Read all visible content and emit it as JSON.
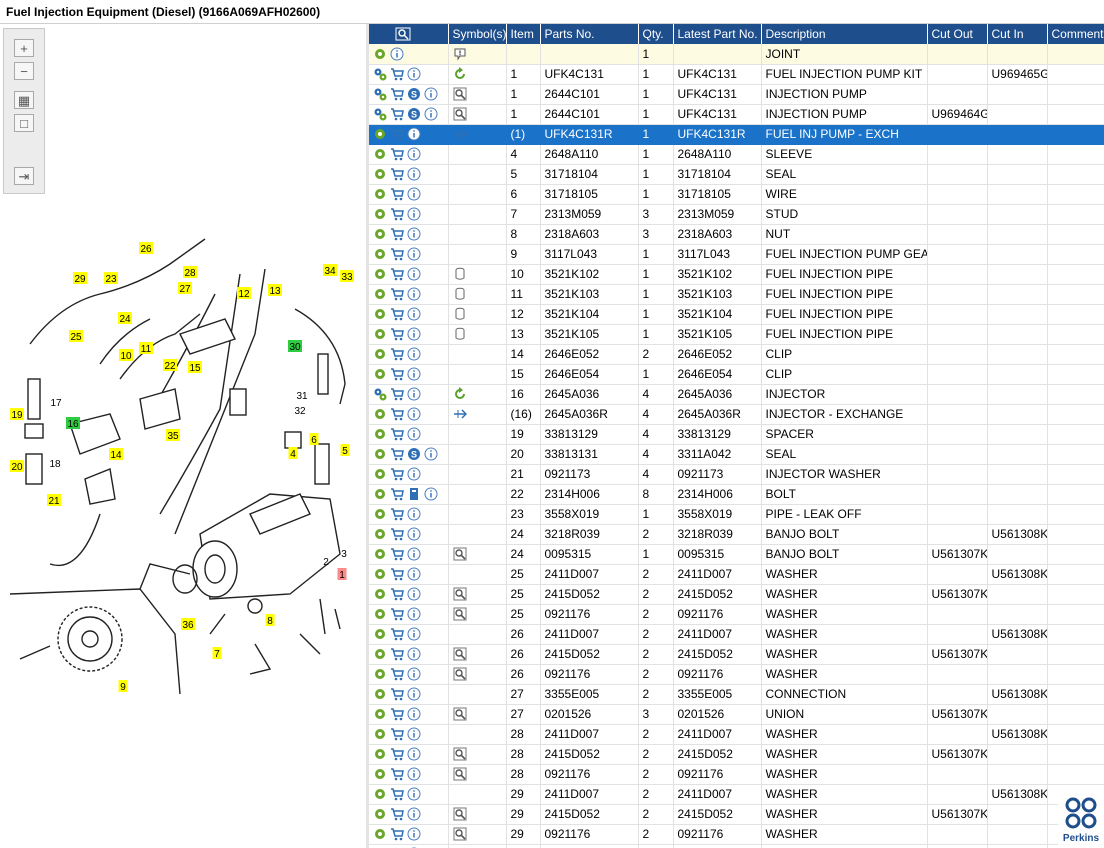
{
  "window": {
    "title": "Fuel Injection Equipment (Diesel) (9166A069AFH02600)"
  },
  "toolbox": {
    "zoom_in": "+",
    "zoom_out": "−",
    "fit": "▦",
    "box": "□",
    "panel": "⇥"
  },
  "columns": [
    "",
    "Symbol(s)",
    "Item",
    "Parts No.",
    "Qty.",
    "Latest Part No.",
    "Description",
    "Cut Out",
    "Cut In",
    "Comment"
  ],
  "rows": [
    {
      "a": [
        "gear",
        "info"
      ],
      "sym": "note",
      "item": "",
      "part": "",
      "qty": "1",
      "latest": "",
      "desc": "JOINT",
      "out": "",
      "in": "",
      "c": "",
      "style": "hl"
    },
    {
      "a": [
        "gears",
        "cart",
        "info"
      ],
      "sym": "refresh",
      "item": "1",
      "part": "UFK4C131",
      "qty": "1",
      "latest": "UFK4C131",
      "desc": "FUEL INJECTION PUMP KIT",
      "out": "",
      "in": "U969465G",
      "c": ""
    },
    {
      "a": [
        "gears",
        "cart",
        "s",
        "info"
      ],
      "sym": "mag",
      "item": "1",
      "part": "2644C101",
      "qty": "1",
      "latest": "UFK4C131",
      "desc": "INJECTION PUMP",
      "out": "",
      "in": "",
      "c": ""
    },
    {
      "a": [
        "gears",
        "cart",
        "s",
        "info"
      ],
      "sym": "mag",
      "item": "1",
      "part": "2644C101",
      "qty": "1",
      "latest": "UFK4C131",
      "desc": "INJECTION PUMP",
      "out": "U969464G",
      "in": "",
      "c": ""
    },
    {
      "a": [
        "gear",
        "cart",
        "info"
      ],
      "sym": "exchange",
      "item": "(1)",
      "part": "UFK4C131R",
      "qty": "1",
      "latest": "UFK4C131R",
      "desc": "FUEL INJ PUMP - EXCH",
      "out": "",
      "in": "",
      "c": "",
      "style": "sel"
    },
    {
      "a": [
        "gear",
        "cart",
        "info"
      ],
      "sym": "",
      "item": "4",
      "part": "2648A110",
      "qty": "1",
      "latest": "2648A110",
      "desc": "SLEEVE",
      "out": "",
      "in": "",
      "c": ""
    },
    {
      "a": [
        "gear",
        "cart",
        "info"
      ],
      "sym": "",
      "item": "5",
      "part": "31718104",
      "qty": "1",
      "latest": "31718104",
      "desc": "SEAL",
      "out": "",
      "in": "",
      "c": ""
    },
    {
      "a": [
        "gear",
        "cart",
        "info"
      ],
      "sym": "",
      "item": "6",
      "part": "31718105",
      "qty": "1",
      "latest": "31718105",
      "desc": "WIRE",
      "out": "",
      "in": "",
      "c": ""
    },
    {
      "a": [
        "gear",
        "cart",
        "info"
      ],
      "sym": "",
      "item": "7",
      "part": "2313M059",
      "qty": "3",
      "latest": "2313M059",
      "desc": "STUD",
      "out": "",
      "in": "",
      "c": ""
    },
    {
      "a": [
        "gear",
        "cart",
        "info"
      ],
      "sym": "",
      "item": "8",
      "part": "2318A603",
      "qty": "3",
      "latest": "2318A603",
      "desc": "NUT",
      "out": "",
      "in": "",
      "c": ""
    },
    {
      "a": [
        "gear",
        "cart",
        "info"
      ],
      "sym": "",
      "item": "9",
      "part": "3117L043",
      "qty": "1",
      "latest": "3117L043",
      "desc": "FUEL INJECTION PUMP GEAR",
      "out": "",
      "in": "",
      "c": ""
    },
    {
      "a": [
        "gear",
        "cart",
        "info"
      ],
      "sym": "can",
      "item": "10",
      "part": "3521K102",
      "qty": "1",
      "latest": "3521K102",
      "desc": "FUEL INJECTION PIPE",
      "out": "",
      "in": "",
      "c": ""
    },
    {
      "a": [
        "gear",
        "cart",
        "info"
      ],
      "sym": "can",
      "item": "11",
      "part": "3521K103",
      "qty": "1",
      "latest": "3521K103",
      "desc": "FUEL INJECTION PIPE",
      "out": "",
      "in": "",
      "c": ""
    },
    {
      "a": [
        "gear",
        "cart",
        "info"
      ],
      "sym": "can",
      "item": "12",
      "part": "3521K104",
      "qty": "1",
      "latest": "3521K104",
      "desc": "FUEL INJECTION PIPE",
      "out": "",
      "in": "",
      "c": ""
    },
    {
      "a": [
        "gear",
        "cart",
        "info"
      ],
      "sym": "can",
      "item": "13",
      "part": "3521K105",
      "qty": "1",
      "latest": "3521K105",
      "desc": "FUEL INJECTION PIPE",
      "out": "",
      "in": "",
      "c": ""
    },
    {
      "a": [
        "gear",
        "cart",
        "info"
      ],
      "sym": "",
      "item": "14",
      "part": "2646E052",
      "qty": "2",
      "latest": "2646E052",
      "desc": "CLIP",
      "out": "",
      "in": "",
      "c": ""
    },
    {
      "a": [
        "gear",
        "cart",
        "info"
      ],
      "sym": "",
      "item": "15",
      "part": "2646E054",
      "qty": "1",
      "latest": "2646E054",
      "desc": "CLIP",
      "out": "",
      "in": "",
      "c": ""
    },
    {
      "a": [
        "gears",
        "cart",
        "info"
      ],
      "sym": "refresh",
      "item": "16",
      "part": "2645A036",
      "qty": "4",
      "latest": "2645A036",
      "desc": "INJECTOR",
      "out": "",
      "in": "",
      "c": ""
    },
    {
      "a": [
        "gear",
        "cart",
        "info"
      ],
      "sym": "exchange",
      "item": "(16)",
      "part": "2645A036R",
      "qty": "4",
      "latest": "2645A036R",
      "desc": "INJECTOR - EXCHANGE",
      "out": "",
      "in": "",
      "c": ""
    },
    {
      "a": [
        "gear",
        "cart",
        "info"
      ],
      "sym": "",
      "item": "19",
      "part": "33813129",
      "qty": "4",
      "latest": "33813129",
      "desc": "SPACER",
      "out": "",
      "in": "",
      "c": ""
    },
    {
      "a": [
        "gear",
        "cart",
        "s",
        "info"
      ],
      "sym": "",
      "item": "20",
      "part": "33813131",
      "qty": "4",
      "latest": "3311A042",
      "desc": "SEAL",
      "out": "",
      "in": "",
      "c": ""
    },
    {
      "a": [
        "gear",
        "cart",
        "info"
      ],
      "sym": "",
      "item": "21",
      "part": "0921173",
      "qty": "4",
      "latest": "0921173",
      "desc": "INJECTOR WASHER",
      "out": "",
      "in": "",
      "c": ""
    },
    {
      "a": [
        "gear",
        "cart",
        "book",
        "info"
      ],
      "sym": "",
      "item": "22",
      "part": "2314H006",
      "qty": "8",
      "latest": "2314H006",
      "desc": "BOLT",
      "out": "",
      "in": "",
      "c": ""
    },
    {
      "a": [
        "gear",
        "cart",
        "info"
      ],
      "sym": "",
      "item": "23",
      "part": "3558X019",
      "qty": "1",
      "latest": "3558X019",
      "desc": "PIPE - LEAK OFF",
      "out": "",
      "in": "",
      "c": ""
    },
    {
      "a": [
        "gear",
        "cart",
        "info"
      ],
      "sym": "",
      "item": "24",
      "part": "3218R039",
      "qty": "2",
      "latest": "3218R039",
      "desc": "BANJO BOLT",
      "out": "",
      "in": "U561308K",
      "c": ""
    },
    {
      "a": [
        "gear",
        "cart",
        "info"
      ],
      "sym": "mag",
      "item": "24",
      "part": "0095315",
      "qty": "1",
      "latest": "0095315",
      "desc": "BANJO BOLT",
      "out": "U561307K",
      "in": "",
      "c": ""
    },
    {
      "a": [
        "gear",
        "cart",
        "info"
      ],
      "sym": "",
      "item": "25",
      "part": "2411D007",
      "qty": "2",
      "latest": "2411D007",
      "desc": "WASHER",
      "out": "",
      "in": "U561308K",
      "c": ""
    },
    {
      "a": [
        "gear",
        "cart",
        "info"
      ],
      "sym": "mag",
      "item": "25",
      "part": "2415D052",
      "qty": "2",
      "latest": "2415D052",
      "desc": "WASHER",
      "out": "U561307K",
      "in": "",
      "c": ""
    },
    {
      "a": [
        "gear",
        "cart",
        "info"
      ],
      "sym": "mag",
      "item": "25",
      "part": "0921176",
      "qty": "2",
      "latest": "0921176",
      "desc": "WASHER",
      "out": "",
      "in": "",
      "c": ""
    },
    {
      "a": [
        "gear",
        "cart",
        "info"
      ],
      "sym": "",
      "item": "26",
      "part": "2411D007",
      "qty": "2",
      "latest": "2411D007",
      "desc": "WASHER",
      "out": "",
      "in": "U561308K",
      "c": ""
    },
    {
      "a": [
        "gear",
        "cart",
        "info"
      ],
      "sym": "mag",
      "item": "26",
      "part": "2415D052",
      "qty": "2",
      "latest": "2415D052",
      "desc": "WASHER",
      "out": "U561307K",
      "in": "",
      "c": ""
    },
    {
      "a": [
        "gear",
        "cart",
        "info"
      ],
      "sym": "mag",
      "item": "26",
      "part": "0921176",
      "qty": "2",
      "latest": "0921176",
      "desc": "WASHER",
      "out": "",
      "in": "",
      "c": ""
    },
    {
      "a": [
        "gear",
        "cart",
        "info"
      ],
      "sym": "",
      "item": "27",
      "part": "3355E005",
      "qty": "2",
      "latest": "3355E005",
      "desc": "CONNECTION",
      "out": "",
      "in": "U561308K",
      "c": ""
    },
    {
      "a": [
        "gear",
        "cart",
        "info"
      ],
      "sym": "mag",
      "item": "27",
      "part": "0201526",
      "qty": "3",
      "latest": "0201526",
      "desc": "UNION",
      "out": "U561307K",
      "in": "",
      "c": ""
    },
    {
      "a": [
        "gear",
        "cart",
        "info"
      ],
      "sym": "",
      "item": "28",
      "part": "2411D007",
      "qty": "2",
      "latest": "2411D007",
      "desc": "WASHER",
      "out": "",
      "in": "U561308K",
      "c": ""
    },
    {
      "a": [
        "gear",
        "cart",
        "info"
      ],
      "sym": "mag",
      "item": "28",
      "part": "2415D052",
      "qty": "2",
      "latest": "2415D052",
      "desc": "WASHER",
      "out": "U561307K",
      "in": "",
      "c": ""
    },
    {
      "a": [
        "gear",
        "cart",
        "info"
      ],
      "sym": "mag",
      "item": "28",
      "part": "0921176",
      "qty": "2",
      "latest": "0921176",
      "desc": "WASHER",
      "out": "",
      "in": "",
      "c": ""
    },
    {
      "a": [
        "gear",
        "cart",
        "info"
      ],
      "sym": "",
      "item": "29",
      "part": "2411D007",
      "qty": "2",
      "latest": "2411D007",
      "desc": "WASHER",
      "out": "",
      "in": "U561308K",
      "c": ""
    },
    {
      "a": [
        "gear",
        "cart",
        "info"
      ],
      "sym": "mag",
      "item": "29",
      "part": "2415D052",
      "qty": "2",
      "latest": "2415D052",
      "desc": "WASHER",
      "out": "U561307K",
      "in": "",
      "c": ""
    },
    {
      "a": [
        "gear",
        "cart",
        "info"
      ],
      "sym": "mag",
      "item": "29",
      "part": "0921176",
      "qty": "2",
      "latest": "0921176",
      "desc": "WASHER",
      "out": "",
      "in": "",
      "c": ""
    },
    {
      "a": [
        "gear",
        "cart",
        "info"
      ],
      "sym": "",
      "item": "",
      "part": "",
      "qty": "",
      "latest": "",
      "desc": "",
      "out": "",
      "in": "",
      "c": ""
    }
  ],
  "callouts": [
    {
      "t": "26",
      "c": "y"
    },
    {
      "t": "29",
      "c": "y"
    },
    {
      "t": "23",
      "c": "y"
    },
    {
      "t": "28",
      "c": "y"
    },
    {
      "t": "27",
      "c": "y"
    },
    {
      "t": "12",
      "c": "y"
    },
    {
      "t": "13",
      "c": "y"
    },
    {
      "t": "34",
      "c": "y"
    },
    {
      "t": "33",
      "c": "y"
    },
    {
      "t": "24",
      "c": "y"
    },
    {
      "t": "25",
      "c": "y"
    },
    {
      "t": "11",
      "c": "y"
    },
    {
      "t": "10",
      "c": "y"
    },
    {
      "t": "22",
      "c": "y"
    },
    {
      "t": "15",
      "c": "y"
    },
    {
      "t": "30",
      "c": "g"
    },
    {
      "t": "19",
      "c": "y"
    },
    {
      "t": "16",
      "c": "g"
    },
    {
      "t": "35",
      "c": "y"
    },
    {
      "t": "14",
      "c": "y"
    },
    {
      "t": "20",
      "c": "y"
    },
    {
      "t": "21",
      "c": "y"
    },
    {
      "t": "6",
      "c": "y"
    },
    {
      "t": "4",
      "c": "y"
    },
    {
      "t": "5",
      "c": "y"
    },
    {
      "t": "1",
      "c": "r"
    },
    {
      "t": "36",
      "c": "y"
    },
    {
      "t": "8",
      "c": "y"
    },
    {
      "t": "7",
      "c": "y"
    },
    {
      "t": "9",
      "c": "y"
    }
  ],
  "plain_labels": [
    "17",
    "18",
    "31",
    "32",
    "2",
    "3"
  ],
  "brand": {
    "name": "Perkins"
  },
  "colors": {
    "header": "#1f4e8c",
    "selected": "#1a73c9",
    "callout_yellow": "#ffff00",
    "callout_green": "#2ecc40",
    "callout_red": "#ff8a8a"
  }
}
